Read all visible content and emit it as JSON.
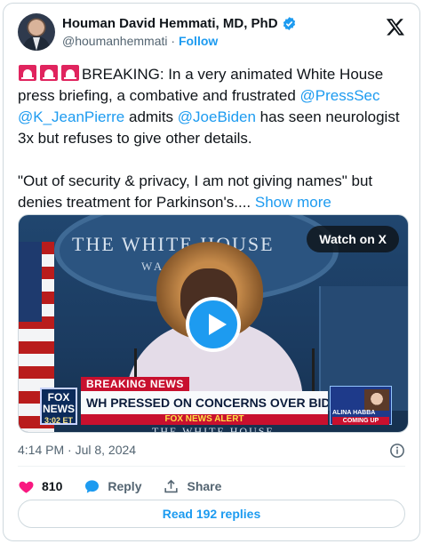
{
  "author": {
    "display_name": "Houman David Hemmati, MD, PhD",
    "handle": "@houmanhemmati",
    "separator": "·",
    "follow_label": "Follow"
  },
  "tweet": {
    "lead": "BREAKING: In a very animated White House press briefing, a combative and frustrated ",
    "mention1": "@PressSec",
    "mention2": "@K_JeanPierre",
    "mid": " admits ",
    "mention3": "@JoeBiden",
    "tail": " has seen neurologist 3x but refuses to give other details.",
    "para2": "\"Out of security & privacy, I am not giving names\" but denies treatment for Parkinson's....",
    "show_more": "Show more"
  },
  "media": {
    "watch_label": "Watch on X",
    "wh_title": "THE WHITE HOUSE",
    "wh_sub": "WASHI",
    "fox_logo": "FOX NEWS",
    "fox_time": "3:02 ET",
    "breaking_label": "BREAKING NEWS",
    "headline": "WH PRESSED ON CONCERNS OVER BIDEN FITNESS",
    "alert": "FOX NEWS ALERT",
    "bottom_sign": "THE WHITE HOUSE",
    "upnext_name": "ALINA HABBA",
    "upnext_tag": "COMING UP"
  },
  "meta": {
    "timestamp": "4:14 PM · Jul 8, 2024"
  },
  "actions": {
    "likes": "810",
    "reply_label": "Reply",
    "share_label": "Share"
  },
  "replies_button": "Read 192 replies",
  "colors": {
    "accent": "#1d9bf0",
    "like": "#f91880",
    "text": "#0f1419",
    "muted": "#536471",
    "siren": "#e0245e"
  },
  "icons": [
    "siren-emoji-icon",
    "verified-badge-icon",
    "x-logo-icon",
    "play-icon",
    "info-icon",
    "heart-icon",
    "reply-bubble-icon",
    "share-icon"
  ]
}
